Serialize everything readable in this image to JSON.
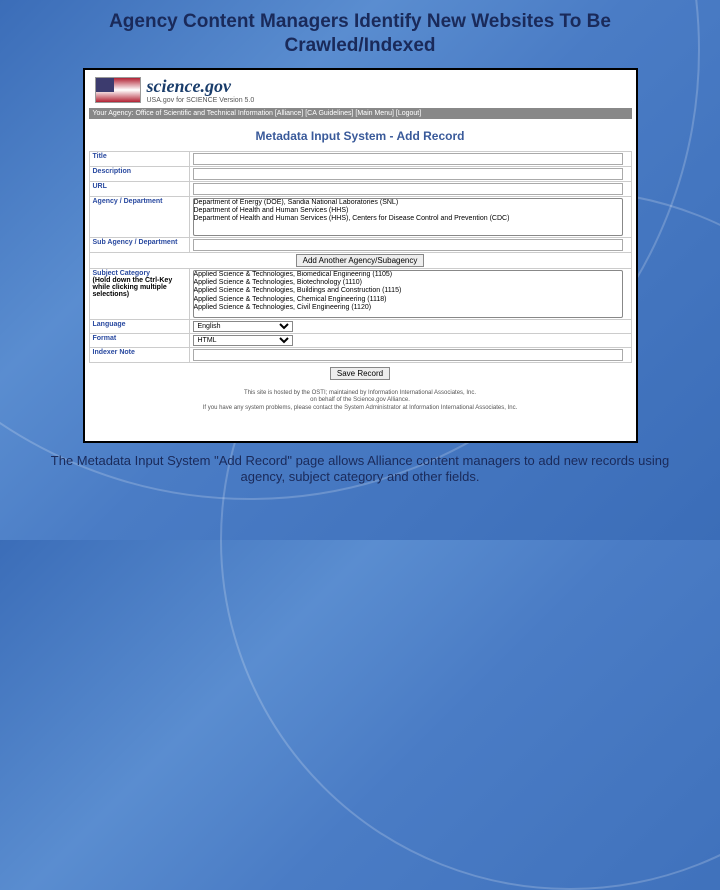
{
  "slide": {
    "title": "Agency Content Managers Identify New Websites To Be Crawled/Indexed",
    "caption": "The Metadata Input System \"Add Record\" page allows Alliance content managers to add new records using agency, subject category and other fields."
  },
  "header": {
    "logo_text": "science.gov",
    "tagline": "USA.gov for SCIENCE     Version 5.0"
  },
  "topbar": "Your Agency: Office of Scientific and Technical Information   [Alliance] [CA Guidelines] [Main Menu] [Logout]",
  "form": {
    "title": "Metadata Input System - Add Record",
    "labels": {
      "title": "Title",
      "description": "Description",
      "url": "URL",
      "agency": "Agency / Department",
      "subagency": "Sub Agency / Department",
      "subject": "Subject Category",
      "subject_hint": "(Hold down the Ctrl-Key while clicking multiple selections)",
      "language": "Language",
      "format": "Format",
      "indexer": "Indexer Note"
    },
    "agency_options": [
      "Department of Energy (DOE), Sandia National Laboratories (SNL)",
      "Department of Health and Human Services (HHS)",
      "Department of Health and Human Services (HHS), Centers for Disease Control and Prevention (CDC)"
    ],
    "subject_options": [
      "Applied Science & Technologies, Biomedical Engineering (1105)",
      "Applied Science & Technologies, Biotechnology (1110)",
      "Applied Science & Technologies, Buildings and Construction (1115)",
      "Applied Science & Technologies, Chemical Engineering (1118)",
      "Applied Science & Technologies, Civil Engineering (1120)"
    ],
    "language_options": [
      "English"
    ],
    "format_options": [
      "HTML"
    ],
    "buttons": {
      "add_agency": "Add Another Agency/Subagency",
      "save": "Save Record"
    }
  },
  "footer": {
    "line1": "This site is hosted by the OSTI; maintained by Information International Associates, Inc.",
    "line2": "If you have any system problems, please contact the System Administrator at Information International Associates, Inc.",
    "line2_prefix": "on behalf of the Science.gov Alliance."
  }
}
